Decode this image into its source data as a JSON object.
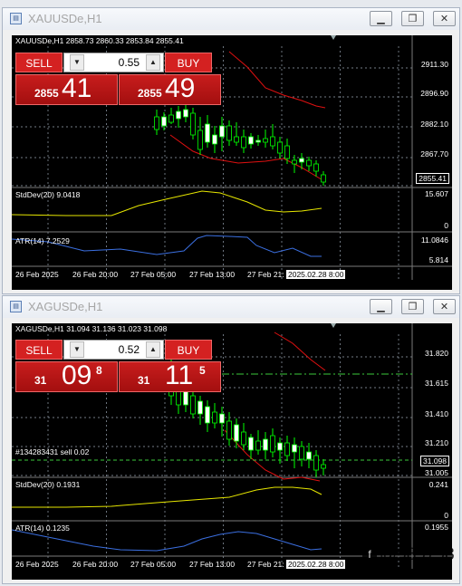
{
  "windows": [
    {
      "title": "XAUUSDe,H1",
      "symbol_label": "XAUUSDe,H1  2858.73 2860.33 2853.84 2855.41",
      "trade_panel": {
        "sell_label": "SELL",
        "buy_label": "BUY",
        "volume": "0.55",
        "bid_small": "2855",
        "bid_big": "41",
        "bid_sup": "",
        "ask_small": "2855",
        "ask_big": "49",
        "ask_sup": ""
      },
      "price_axis": [
        "2911.30",
        "2896.90",
        "2882.10",
        "2867.70"
      ],
      "current_price": "2855.41",
      "trade_line_label": "",
      "stddev_label": "StdDev(20) 9.0418",
      "stddev_axis": [
        "15.607",
        "0"
      ],
      "atr_label": "ATR(14) 7.2529",
      "atr_axis": [
        "11.0846",
        "5.814"
      ],
      "time_axis": [
        "26 Feb 2025",
        "26 Feb 20:00",
        "27 Feb 05:00",
        "27 Feb 13:00",
        "27 Feb 21:"
      ],
      "cursor_time": "2025.02.28 8:00"
    },
    {
      "title": "XAGUSDe,H1",
      "symbol_label": "XAGUSDe,H1  31.094 31.136 31.023 31.098",
      "trade_panel": {
        "sell_label": "SELL",
        "buy_label": "BUY",
        "volume": "0.52",
        "bid_small": "31",
        "bid_big": "09",
        "bid_sup": "8",
        "ask_small": "31",
        "ask_big": "11",
        "ask_sup": "5"
      },
      "price_axis": [
        "31.820",
        "31.615",
        "31.410",
        "31.210",
        "31.005"
      ],
      "current_price": "31.098",
      "trade_line_label": "#134283431 sell 0.02",
      "stddev_label": "StdDev(20) 0.1931",
      "stddev_axis": [
        "0.241",
        "0"
      ],
      "atr_label": "ATR(14) 0.1235",
      "atr_axis": [
        "0.1955",
        ""
      ],
      "time_axis": [
        "26 Feb 2025",
        "26 Feb 20:00",
        "27 Feb 05:00",
        "27 Feb 13:00",
        "27 Feb 21:"
      ],
      "cursor_time": "2025.02.28 8:00"
    }
  ],
  "colors": {
    "bull_candle": "#ffffff",
    "bear_candle": "#000000",
    "candle_border": "#00ff00",
    "band_red": "#e01010",
    "stddev_line": "#e6e600",
    "atr_line": "#3b6fe0",
    "grid": "#9ba5b3"
  },
  "watermark": {
    "icon": "f",
    "text": "@989798"
  },
  "icons": {
    "chart_icon": "chart-window-icon",
    "minimize": "minimize-icon",
    "restore": "restore-icon",
    "close": "close-icon"
  }
}
